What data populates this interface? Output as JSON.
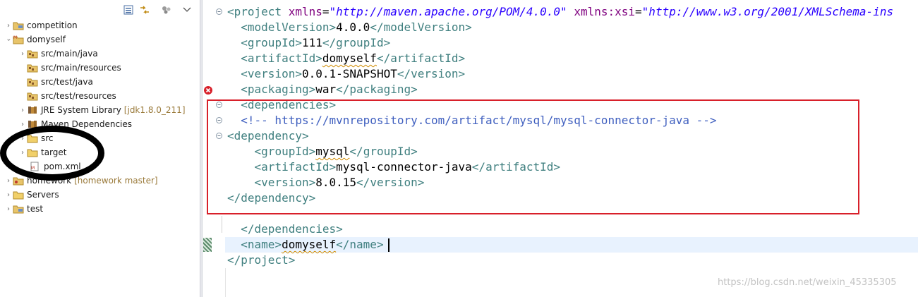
{
  "project_explorer": {
    "items": [
      {
        "label": "competition",
        "decoration": "",
        "twisty": "collapsed",
        "icon": "project-icon"
      },
      {
        "label": "domyself",
        "decoration": "",
        "twisty": "expanded",
        "icon": "maven-project-icon"
      },
      {
        "label": "src/main/java",
        "decoration": "",
        "twisty": "collapsed",
        "icon": "source-folder-icon"
      },
      {
        "label": "src/main/resources",
        "decoration": "",
        "twisty": "none",
        "icon": "source-folder-icon"
      },
      {
        "label": "src/test/java",
        "decoration": "",
        "twisty": "none",
        "icon": "source-folder-icon"
      },
      {
        "label": "src/test/resources",
        "decoration": "",
        "twisty": "none",
        "icon": "source-folder-icon"
      },
      {
        "label": "JRE System Library",
        "decoration": "[jdk1.8.0_211]",
        "twisty": "collapsed",
        "icon": "library-icon"
      },
      {
        "label": "Maven Dependencies",
        "decoration": "",
        "twisty": "collapsed",
        "icon": "library-icon"
      },
      {
        "label": "src",
        "decoration": "",
        "twisty": "collapsed",
        "icon": "folder-icon"
      },
      {
        "label": "target",
        "decoration": "",
        "twisty": "collapsed",
        "icon": "folder-icon"
      },
      {
        "label": "pom.xml",
        "decoration": "",
        "twisty": "none",
        "icon": "xml-file-icon"
      },
      {
        "label": "homework",
        "decoration": "[homework master]",
        "twisty": "collapsed",
        "icon": "git-project-icon"
      },
      {
        "label": "Servers",
        "decoration": "",
        "twisty": "collapsed",
        "icon": "folder-icon"
      },
      {
        "label": "test",
        "decoration": "",
        "twisty": "collapsed",
        "icon": "project-icon"
      }
    ]
  },
  "editor": {
    "lines": {
      "l1": {
        "open": "<",
        "tag": "project",
        "attr1": "xmlns",
        "eq1": "=",
        "val1": "\"http://maven.apache.org/POM/4.0.0\"",
        "attr2": "xmlns:xsi",
        "eq2": "=",
        "val2": "\"http://www.w3.org/2001/XMLSchema-ins"
      },
      "l2": {
        "indent": "  ",
        "o": "<",
        "tag": "modelVersion",
        "c": ">",
        "text": "4.0.0",
        "e": "</",
        "tag2": "modelVersion",
        "f": ">"
      },
      "l3": {
        "indent": "  ",
        "o": "<",
        "tag": "groupId",
        "c": ">",
        "text": "111",
        "e": "</",
        "tag2": "groupId",
        "f": ">"
      },
      "l4": {
        "indent": "  ",
        "o": "<",
        "tag": "artifactId",
        "c": ">",
        "text": "domyself",
        "e": "</",
        "tag2": "artifactId",
        "f": ">"
      },
      "l5": {
        "indent": "  ",
        "o": "<",
        "tag": "version",
        "c": ">",
        "text": "0.0.1-SNAPSHOT",
        "e": "</",
        "tag2": "version",
        "f": ">"
      },
      "l6": {
        "indent": "  ",
        "o": "<",
        "tag": "packaging",
        "c": ">",
        "text": "war",
        "e": "</",
        "tag2": "packaging",
        "f": ">"
      },
      "l7": {
        "indent": "  ",
        "o": "<",
        "tag": "dependencies",
        "c": ">"
      },
      "l8": {
        "indent": "  ",
        "comment": "<!-- https://mvnrepository.com/artifact/mysql/mysql-connector-java -->"
      },
      "l9": {
        "indent": "",
        "o": "<",
        "tag": "dependency",
        "c": ">"
      },
      "l10": {
        "indent": "    ",
        "o": "<",
        "tag": "groupId",
        "c": ">",
        "text": "mysql",
        "e": "</",
        "tag2": "groupId",
        "f": ">"
      },
      "l11": {
        "indent": "    ",
        "o": "<",
        "tag": "artifactId",
        "c": ">",
        "text": "mysql-connector-java",
        "e": "</",
        "tag2": "artifactId",
        "f": ">"
      },
      "l12": {
        "indent": "    ",
        "o": "<",
        "tag": "version",
        "c": ">",
        "text": "8.0.15",
        "e": "</",
        "tag2": "version",
        "f": ">"
      },
      "l13": {
        "indent": "",
        "e": "</",
        "tag": "dependency",
        "f": ">"
      },
      "l15": {
        "indent": "  ",
        "e": "</",
        "tag": "dependencies",
        "f": ">"
      },
      "l16": {
        "indent": "  ",
        "o": "<",
        "tag": "name",
        "c": ">",
        "text": "domyself",
        "e": "</",
        "tag2": "name",
        "f": ">"
      },
      "l17": {
        "indent": "",
        "e": "</",
        "tag": "project",
        "f": ">"
      }
    }
  },
  "watermark": "https://blog.csdn.net/weixin_45335305",
  "colors": {
    "tag": "#3f7f7f",
    "attribute": "#7f007f",
    "attribute_value": "#2a00ff",
    "comment": "#3f5fbf",
    "annotation_box": "#d8202a",
    "current_line": "#e8f2fe"
  }
}
